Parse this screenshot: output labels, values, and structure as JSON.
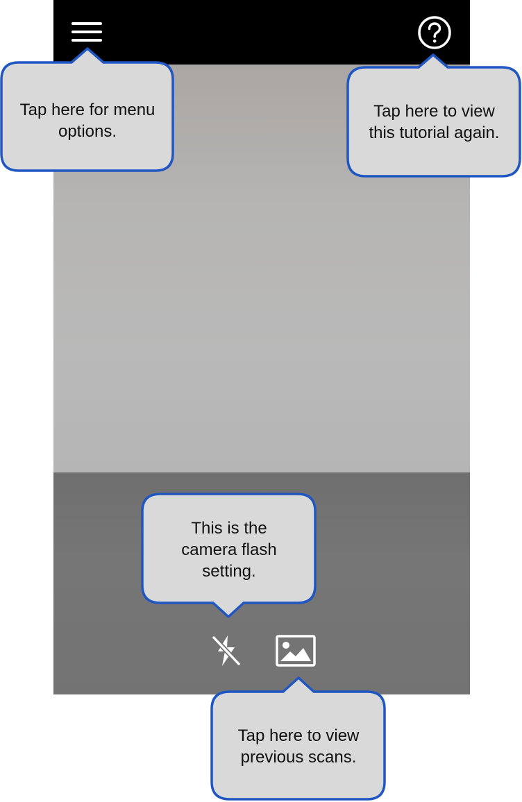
{
  "top_bar": {
    "menu_icon": "hamburger-menu-icon",
    "help_icon": "question-circle-icon"
  },
  "bottom_bar": {
    "flash_icon": "flash-off-icon",
    "gallery_icon": "image-gallery-icon"
  },
  "callouts": {
    "menu": "Tap here for menu\noptions.",
    "help": "Tap here to view\nthis tutorial again.",
    "flash": "This is the\ncamera flash\nsetting.",
    "gallery": "Tap here to view\nprevious scans."
  },
  "colors": {
    "callout_fill": "#d9d9d9",
    "callout_border": "#1f56c2",
    "top_bar": "#000000",
    "bottom_panel": "#737373"
  }
}
